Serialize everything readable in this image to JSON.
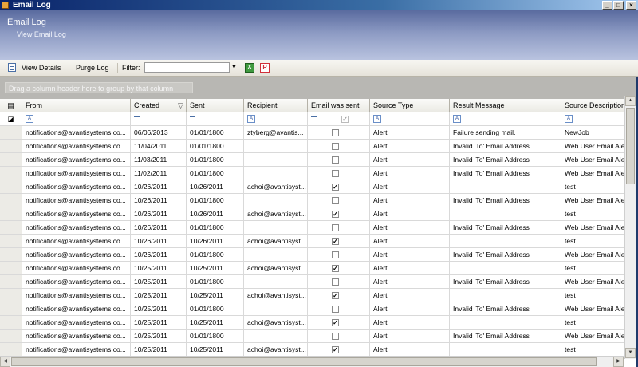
{
  "window": {
    "title": "Email Log",
    "controls": [
      "_",
      "□",
      "×"
    ]
  },
  "header": {
    "title": "Email Log",
    "subtitle": "View Email Log"
  },
  "toolbar": {
    "view_details": "View Details",
    "purge_log": "Purge Log",
    "filter_label": "Filter:",
    "filter_value": "",
    "export_excel_icon": "excel-export-icon",
    "export_pdf_icon": "pdf-export-icon"
  },
  "grid": {
    "group_prompt": "Drag a column header here to group by that column",
    "columns": [
      {
        "label": "From"
      },
      {
        "label": "Created",
        "sort": "descending"
      },
      {
        "label": "Sent"
      },
      {
        "label": "Recipient"
      },
      {
        "label": "Email was sent"
      },
      {
        "label": "Source Type"
      },
      {
        "label": "Result Message"
      },
      {
        "label": "Source Description"
      }
    ],
    "filter_row": {
      "text_filter_glyph": "A",
      "equals_glyph": "="
    },
    "rows": [
      {
        "from": "notifications@avantisystems.co...",
        "created": "06/06/2013",
        "sent": "01/01/1800",
        "recipient": "ztyberg@avantis...",
        "sent_flag": false,
        "source_type": "Alert",
        "result": "Failure sending mail.",
        "description": "NewJob"
      },
      {
        "from": "notifications@avantisystems.co...",
        "created": "11/04/2011",
        "sent": "01/01/1800",
        "recipient": "",
        "sent_flag": false,
        "source_type": "Alert",
        "result": "Invalid 'To' Email Address",
        "description": "Web User Email Ale"
      },
      {
        "from": "notifications@avantisystems.co...",
        "created": "11/03/2011",
        "sent": "01/01/1800",
        "recipient": "",
        "sent_flag": false,
        "source_type": "Alert",
        "result": "Invalid 'To' Email Address",
        "description": "Web User Email Ale"
      },
      {
        "from": "notifications@avantisystems.co...",
        "created": "11/02/2011",
        "sent": "01/01/1800",
        "recipient": "",
        "sent_flag": false,
        "source_type": "Alert",
        "result": "Invalid 'To' Email Address",
        "description": "Web User Email Ale"
      },
      {
        "from": "notifications@avantisystems.co...",
        "created": "10/26/2011",
        "sent": "10/26/2011",
        "recipient": "achoi@avantisyst...",
        "sent_flag": true,
        "source_type": "Alert",
        "result": "",
        "description": "test"
      },
      {
        "from": "notifications@avantisystems.co...",
        "created": "10/26/2011",
        "sent": "01/01/1800",
        "recipient": "",
        "sent_flag": false,
        "source_type": "Alert",
        "result": "Invalid 'To' Email Address",
        "description": "Web User Email Ale"
      },
      {
        "from": "notifications@avantisystems.co...",
        "created": "10/26/2011",
        "sent": "10/26/2011",
        "recipient": "achoi@avantisyst...",
        "sent_flag": true,
        "source_type": "Alert",
        "result": "",
        "description": "test"
      },
      {
        "from": "notifications@avantisystems.co...",
        "created": "10/26/2011",
        "sent": "01/01/1800",
        "recipient": "",
        "sent_flag": false,
        "source_type": "Alert",
        "result": "Invalid 'To' Email Address",
        "description": "Web User Email Ale"
      },
      {
        "from": "notifications@avantisystems.co...",
        "created": "10/26/2011",
        "sent": "10/26/2011",
        "recipient": "achoi@avantisyst...",
        "sent_flag": true,
        "source_type": "Alert",
        "result": "",
        "description": "test"
      },
      {
        "from": "notifications@avantisystems.co...",
        "created": "10/26/2011",
        "sent": "01/01/1800",
        "recipient": "",
        "sent_flag": false,
        "source_type": "Alert",
        "result": "Invalid 'To' Email Address",
        "description": "Web User Email Ale"
      },
      {
        "from": "notifications@avantisystems.co...",
        "created": "10/25/2011",
        "sent": "10/25/2011",
        "recipient": "achoi@avantisyst...",
        "sent_flag": true,
        "source_type": "Alert",
        "result": "",
        "description": "test"
      },
      {
        "from": "notifications@avantisystems.co...",
        "created": "10/25/2011",
        "sent": "01/01/1800",
        "recipient": "",
        "sent_flag": false,
        "source_type": "Alert",
        "result": "Invalid 'To' Email Address",
        "description": "Web User Email Ale"
      },
      {
        "from": "notifications@avantisystems.co...",
        "created": "10/25/2011",
        "sent": "10/25/2011",
        "recipient": "achoi@avantisyst...",
        "sent_flag": true,
        "source_type": "Alert",
        "result": "",
        "description": "test"
      },
      {
        "from": "notifications@avantisystems.co...",
        "created": "10/25/2011",
        "sent": "01/01/1800",
        "recipient": "",
        "sent_flag": false,
        "source_type": "Alert",
        "result": "Invalid 'To' Email Address",
        "description": "Web User Email Ale"
      },
      {
        "from": "notifications@avantisystems.co...",
        "created": "10/25/2011",
        "sent": "10/25/2011",
        "recipient": "achoi@avantisyst...",
        "sent_flag": true,
        "source_type": "Alert",
        "result": "",
        "description": "test"
      },
      {
        "from": "notifications@avantisystems.co...",
        "created": "10/25/2011",
        "sent": "01/01/1800",
        "recipient": "",
        "sent_flag": false,
        "source_type": "Alert",
        "result": "Invalid 'To' Email Address",
        "description": "Web User Email Ale"
      },
      {
        "from": "notifications@avantisystems.co...",
        "created": "10/25/2011",
        "sent": "10/25/2011",
        "recipient": "achoi@avantisyst...",
        "sent_flag": true,
        "source_type": "Alert",
        "result": "",
        "description": "test"
      }
    ]
  }
}
